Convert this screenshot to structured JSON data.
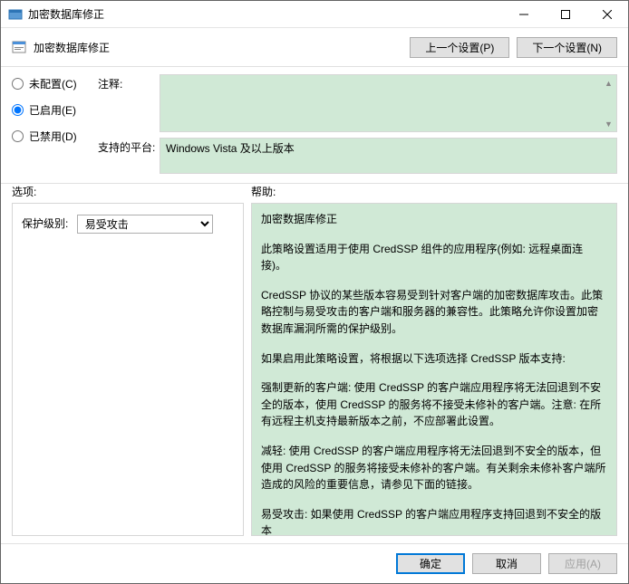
{
  "window": {
    "title": "加密数据库修正"
  },
  "subheader": {
    "title": "加密数据库修正",
    "prev_button": "上一个设置(P)",
    "next_button": "下一个设置(N)"
  },
  "radios": {
    "not_configured": "未配置(C)",
    "enabled": "已启用(E)",
    "disabled": "已禁用(D)",
    "selected": "enabled"
  },
  "fields": {
    "comment_label": "注释:",
    "comment_value": "",
    "platform_label": "支持的平台:",
    "platform_value": "Windows Vista 及以上版本"
  },
  "section_labels": {
    "options": "选项:",
    "help": "帮助:"
  },
  "options": {
    "protection_label": "保护级别:",
    "protection_value": "易受攻击",
    "protection_choices": [
      "易受攻击",
      "减轻",
      "强制更新的客户端"
    ]
  },
  "help": {
    "p1": "加密数据库修正",
    "p2": "此策略设置适用于使用 CredSSP 组件的应用程序(例如: 远程桌面连接)。",
    "p3": "CredSSP 协议的某些版本容易受到针对客户端的加密数据库攻击。此策略控制与易受攻击的客户端和服务器的兼容性。此策略允许你设置加密数据库漏洞所需的保护级别。",
    "p4": "如果启用此策略设置，将根据以下选项选择 CredSSP 版本支持:",
    "p5": "强制更新的客户端: 使用 CredSSP 的客户端应用程序将无法回退到不安全的版本，使用 CredSSP 的服务将不接受未修补的客户端。注意: 在所有远程主机支持最新版本之前，不应部署此设置。",
    "p6": "减轻: 使用 CredSSP 的客户端应用程序将无法回退到不安全的版本，但使用 CredSSP 的服务将接受未修补的客户端。有关剩余未修补客户端所造成的风险的重要信息，请参见下面的链接。",
    "p7": "易受攻击: 如果使用 CredSSP 的客户端应用程序支持回退到不安全的版本"
  },
  "footer": {
    "ok": "确定",
    "cancel": "取消",
    "apply": "应用(A)"
  }
}
